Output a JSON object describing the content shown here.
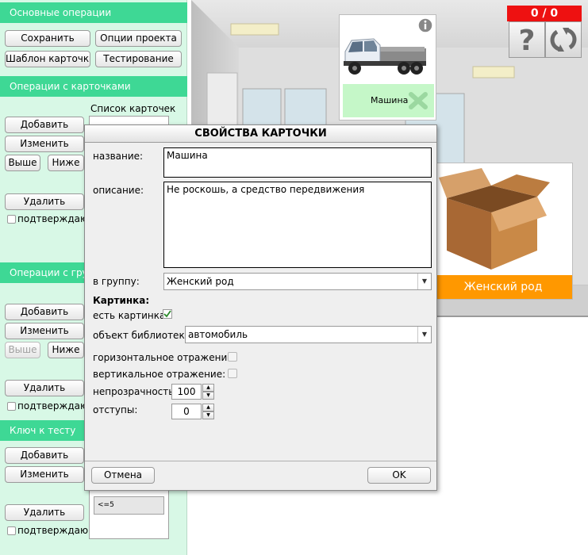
{
  "sidebar": {
    "basic_ops": {
      "header": "Основные операции",
      "save": "Сохранить",
      "project_options": "Опции проекта",
      "card_template": "Шаблон карточки",
      "testing": "Тестирование"
    },
    "card_ops": {
      "header": "Операции с карточками",
      "list_label": "Список карточек",
      "add": "Добавить",
      "edit": "Изменить",
      "up": "Выше",
      "down": "Ниже",
      "delete": "Удалить",
      "confirm": "подтверждаю"
    },
    "group_ops": {
      "header": "Операции с груп",
      "add": "Добавить",
      "edit": "Изменить",
      "up": "Выше",
      "down": "Ниже",
      "delete": "Удалить",
      "confirm": "подтверждаю"
    },
    "test_key": {
      "header": "Ключ к тесту",
      "add": "Добавить",
      "edit": "Изменить",
      "delete": "Удалить",
      "confirm": "подтверждаю",
      "list_item": "<=5"
    }
  },
  "preview": {
    "score": "0 / 0",
    "help_icon": "question-mark-icon",
    "reset_icon": "refresh-icon",
    "info_icon": "info-icon",
    "card1_label": "Машина",
    "card2_label": "Женский род",
    "colors": {
      "score_bg": "#ee1111",
      "card1_label_bg": "#c5f7c8",
      "card2_label_bg": "#ff9800",
      "sidebar_header_bg": "#3ed895",
      "sidebar_bg": "#d8f8e6"
    }
  },
  "dialog": {
    "title": "СВОЙСТВА КАРТОЧКИ",
    "name_label": "название:",
    "name_value": "Машина",
    "description_label": "описание:",
    "description_value": "Не роскошь, а средство передвижения",
    "group_label": "в группу:",
    "group_value": "Женский род",
    "picture_section": "Картинка:",
    "has_picture_label": "есть картинка:",
    "has_picture_checked": true,
    "library_label": "объект библиотеки:",
    "library_value": "автомобиль",
    "hflip_label": "горизонтальное отражение:",
    "vflip_label": "вертикальное отражение:",
    "opacity_label": "непрозрачность:",
    "opacity_value": "100",
    "padding_label": "отступы:",
    "padding_value": "0",
    "cancel": "Отмена",
    "ok": "OK"
  }
}
